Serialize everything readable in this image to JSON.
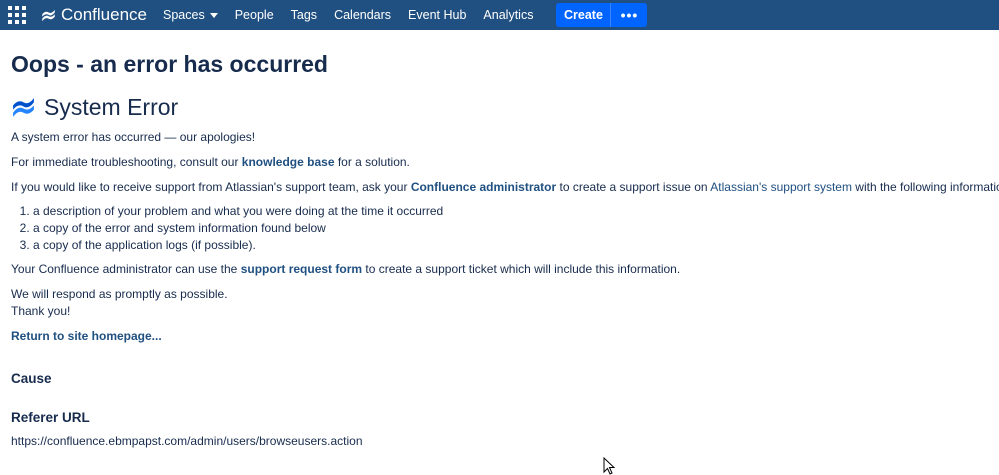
{
  "nav": {
    "brand": "Confluence",
    "items": [
      {
        "label": "Spaces",
        "dropdown": true
      },
      {
        "label": "People"
      },
      {
        "label": "Tags"
      },
      {
        "label": "Calendars"
      },
      {
        "label": "Event Hub"
      },
      {
        "label": "Analytics"
      }
    ],
    "create_label": "Create",
    "more_label": "•••"
  },
  "page": {
    "title": "Oops - an error has occurred",
    "subtitle": "System Error",
    "line1": "A system error has occurred — our apologies!",
    "line2_pre": "For immediate troubleshooting, consult our ",
    "line2_link": "knowledge base",
    "line2_post": " for a solution.",
    "line3_pre": "If you would like to receive support from Atlassian's support team, ask your ",
    "line3_link1": "Confluence administrator",
    "line3_mid": " to create a support issue on ",
    "line3_link2": "Atlassian's support system",
    "line3_post": " with the following information:",
    "list": [
      "a description of your problem and what you were doing at the time it occurred",
      "a copy of the error and system information found below",
      "a copy of the application logs (if possible)."
    ],
    "line4_pre": "Your Confluence administrator can use the ",
    "line4_link": "support request form",
    "line4_post": " to create a support ticket which will include this information.",
    "line5": "We will respond as promptly as possible.",
    "line6": "Thank you!",
    "return_link": "Return to site homepage...",
    "cause_heading": "Cause",
    "referer_heading": "Referer URL",
    "referer_url": "https://confluence.ebmpapst.com/admin/users/browseusers.action"
  },
  "colors": {
    "topbar": "#205081",
    "create": "#0065ff",
    "link": "#205081",
    "text": "#172b4d"
  }
}
